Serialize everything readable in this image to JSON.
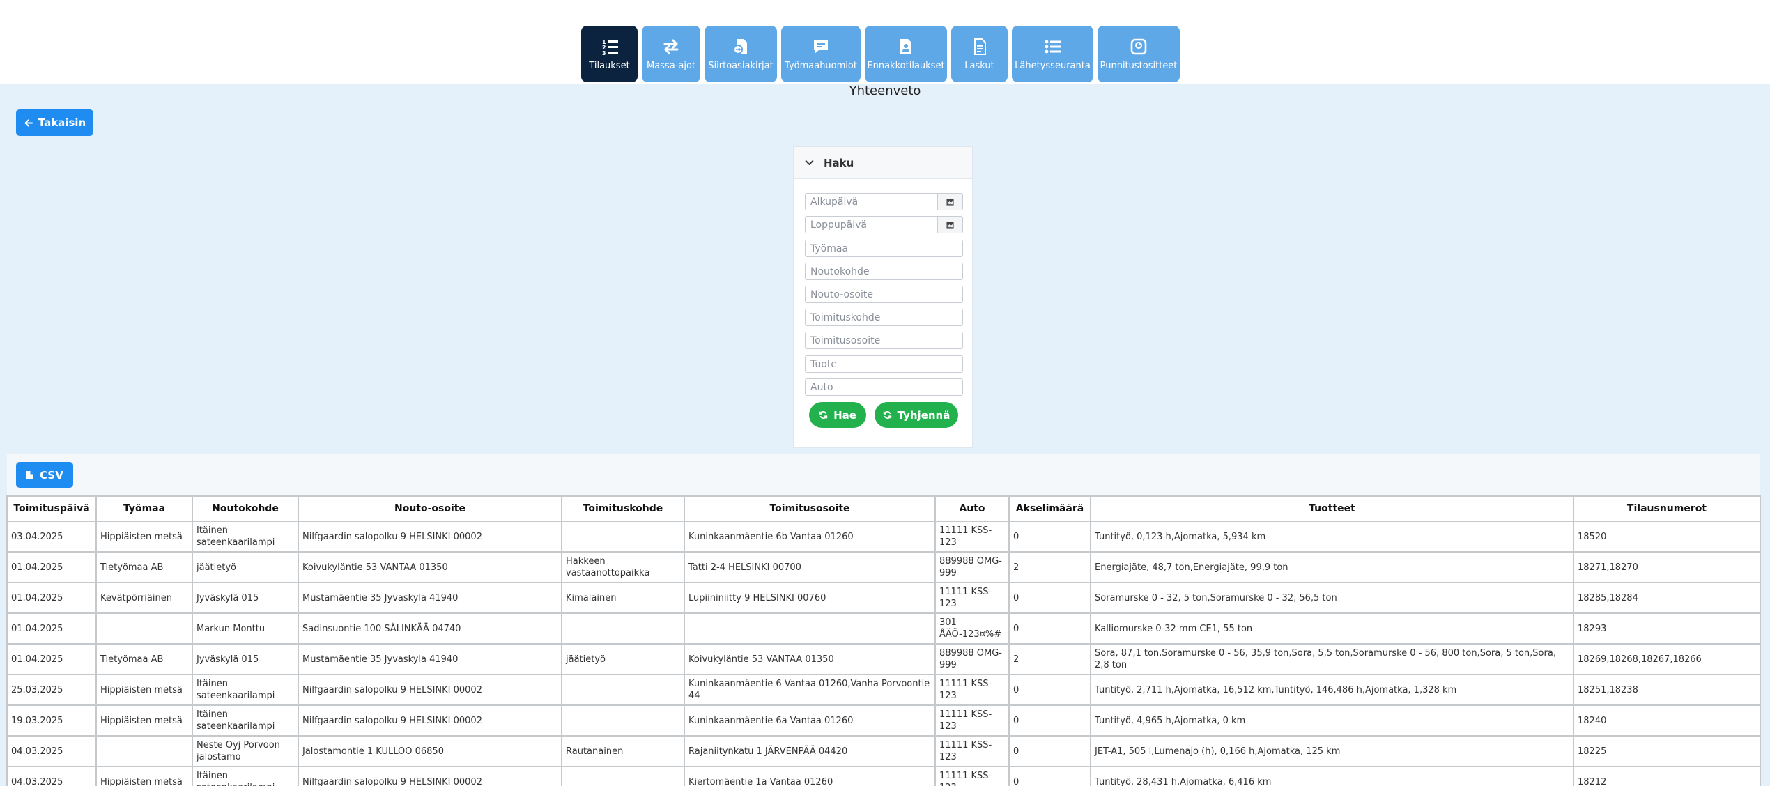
{
  "nav": [
    {
      "label": "Tilaukset",
      "icon": "list-numbered-icon",
      "active": true
    },
    {
      "label": "Massa-ajot",
      "icon": "exchange-arrows-icon",
      "active": false
    },
    {
      "label": "Siirtoasiakirjat",
      "icon": "file-transfer-icon",
      "active": false
    },
    {
      "label": "Työmaahuomiot",
      "icon": "comment-icon",
      "active": false
    },
    {
      "label": "Ennakkotilaukset",
      "icon": "file-person-icon",
      "active": false
    },
    {
      "label": "Laskut",
      "icon": "invoice-icon",
      "active": false
    },
    {
      "label": "Lähetysseuranta",
      "icon": "list-icon",
      "active": false
    },
    {
      "label": "Punnitustositteet",
      "icon": "scale-icon",
      "active": false
    }
  ],
  "page_title": "Yhteenveto",
  "back_button": "Takaisin",
  "search": {
    "title": "Haku",
    "fields": {
      "start_date": "Alkupäivä",
      "end_date": "Loppupäivä",
      "site": "Työmaa",
      "pickup_target": "Noutokohde",
      "pickup_address": "Nouto-osoite",
      "delivery_target": "Toimituskohde",
      "delivery_address": "Toimitusosoite",
      "product": "Tuote",
      "vehicle": "Auto"
    },
    "search_button": "Hae",
    "clear_button": "Tyhjennä"
  },
  "csv_button": "CSV",
  "table": {
    "columns": [
      "Toimituspäivä",
      "Työmaa",
      "Noutokohde",
      "Nouto-osoite",
      "Toimituskohde",
      "Toimitusosoite",
      "Auto",
      "Akselimäärä",
      "Tuotteet",
      "Tilausnumerot"
    ],
    "rows": [
      [
        "03.04.2025",
        "Hippiäisten metsä",
        "Itäinen sateenkaarilampi",
        "Nilfgaardin salopolku 9 HELSINKI 00002",
        "",
        "Kuninkaanmäentie 6b Vantaa 01260",
        "11111 KSS-123",
        "0",
        "Tuntityö, 0,123 h,Ajomatka, 5,934 km",
        "18520"
      ],
      [
        "01.04.2025",
        "Tietyömaa AB",
        "jäätietyö",
        "Koivukyläntie 53 VANTAA 01350",
        "Hakkeen vastaanottopaikka",
        "Tatti 2-4 HELSINKI 00700",
        "889988 OMG-999",
        "2",
        "Energiajäte, 48,7 ton,Energiajäte, 99,9 ton",
        "18271,18270"
      ],
      [
        "01.04.2025",
        "Kevätpörriäinen",
        "Jyväskylä 015",
        "Mustamäentie 35 Jyvaskyla 41940",
        "Kimalainen",
        "Lupiininiitty 9 HELSINKI 00760",
        "11111 KSS-123",
        "0",
        "Soramurske 0 - 32, 5 ton,Soramurske 0 - 32, 56,5 ton",
        "18285,18284"
      ],
      [
        "01.04.2025",
        "",
        "Markun Monttu",
        "Sadinsuontie 100 SÄLINKÄÄ 04740",
        "",
        "",
        "301 ÅÄÖ-123¤%#",
        "0",
        "Kalliomurske 0-32 mm CE1, 55 ton",
        "18293"
      ],
      [
        "01.04.2025",
        "Tietyömaa AB",
        "Jyväskylä 015",
        "Mustamäentie 35 Jyvaskyla 41940",
        "jäätietyö",
        "Koivukyläntie 53 VANTAA 01350",
        "889988 OMG-999",
        "2",
        "Sora, 87,1 ton,Soramurske 0 - 56, 35,9 ton,Sora, 5,5 ton,Soramurske 0 - 56, 800 ton,Sora, 5 ton,Sora, 2,8 ton",
        "18269,18268,18267,18266"
      ],
      [
        "25.03.2025",
        "Hippiäisten metsä",
        "Itäinen sateenkaarilampi",
        "Nilfgaardin salopolku 9 HELSINKI 00002",
        "",
        "Kuninkaanmäentie 6 Vantaa 01260,Vanha Porvoontie 44",
        "11111 KSS-123",
        "0",
        "Tuntityö, 2,711 h,Ajomatka, 16,512 km,Tuntityö, 146,486 h,Ajomatka, 1,328 km",
        "18251,18238"
      ],
      [
        "19.03.2025",
        "Hippiäisten metsä",
        "Itäinen sateenkaarilampi",
        "Nilfgaardin salopolku 9 HELSINKI 00002",
        "",
        "Kuninkaanmäentie 6a Vantaa 01260",
        "11111 KSS-123",
        "0",
        "Tuntityö, 4,965 h,Ajomatka, 0 km",
        "18240"
      ],
      [
        "04.03.2025",
        "",
        "Neste Oyj Porvoon jalostamo",
        "Jalostamontie 1 KULLOO 06850",
        "Rautanainen",
        "Rajaniitynkatu 1 JÄRVENPÄÄ 04420",
        "11111 KSS-123",
        "0",
        "JET-A1, 505 l,Lumenajo (h), 0,166 h,Ajomatka, 125 km",
        "18225"
      ],
      [
        "04.03.2025",
        "Hippiäisten metsä",
        "Itäinen sateenkaarilampi",
        "Nilfgaardin salopolku 9 HELSINKI 00002",
        "",
        "Kiertomäentie 1a Vantaa 01260",
        "11111 KSS-123",
        "0",
        "Tuntityö, 28,431 h,Ajomatka, 6,416 km",
        "18212"
      ]
    ]
  },
  "colors": {
    "nav_active": "#0c2340",
    "nav": "#5fa8e8",
    "primary": "#1e8cf0",
    "success": "#22b14c",
    "background": "#e4f0fa"
  }
}
